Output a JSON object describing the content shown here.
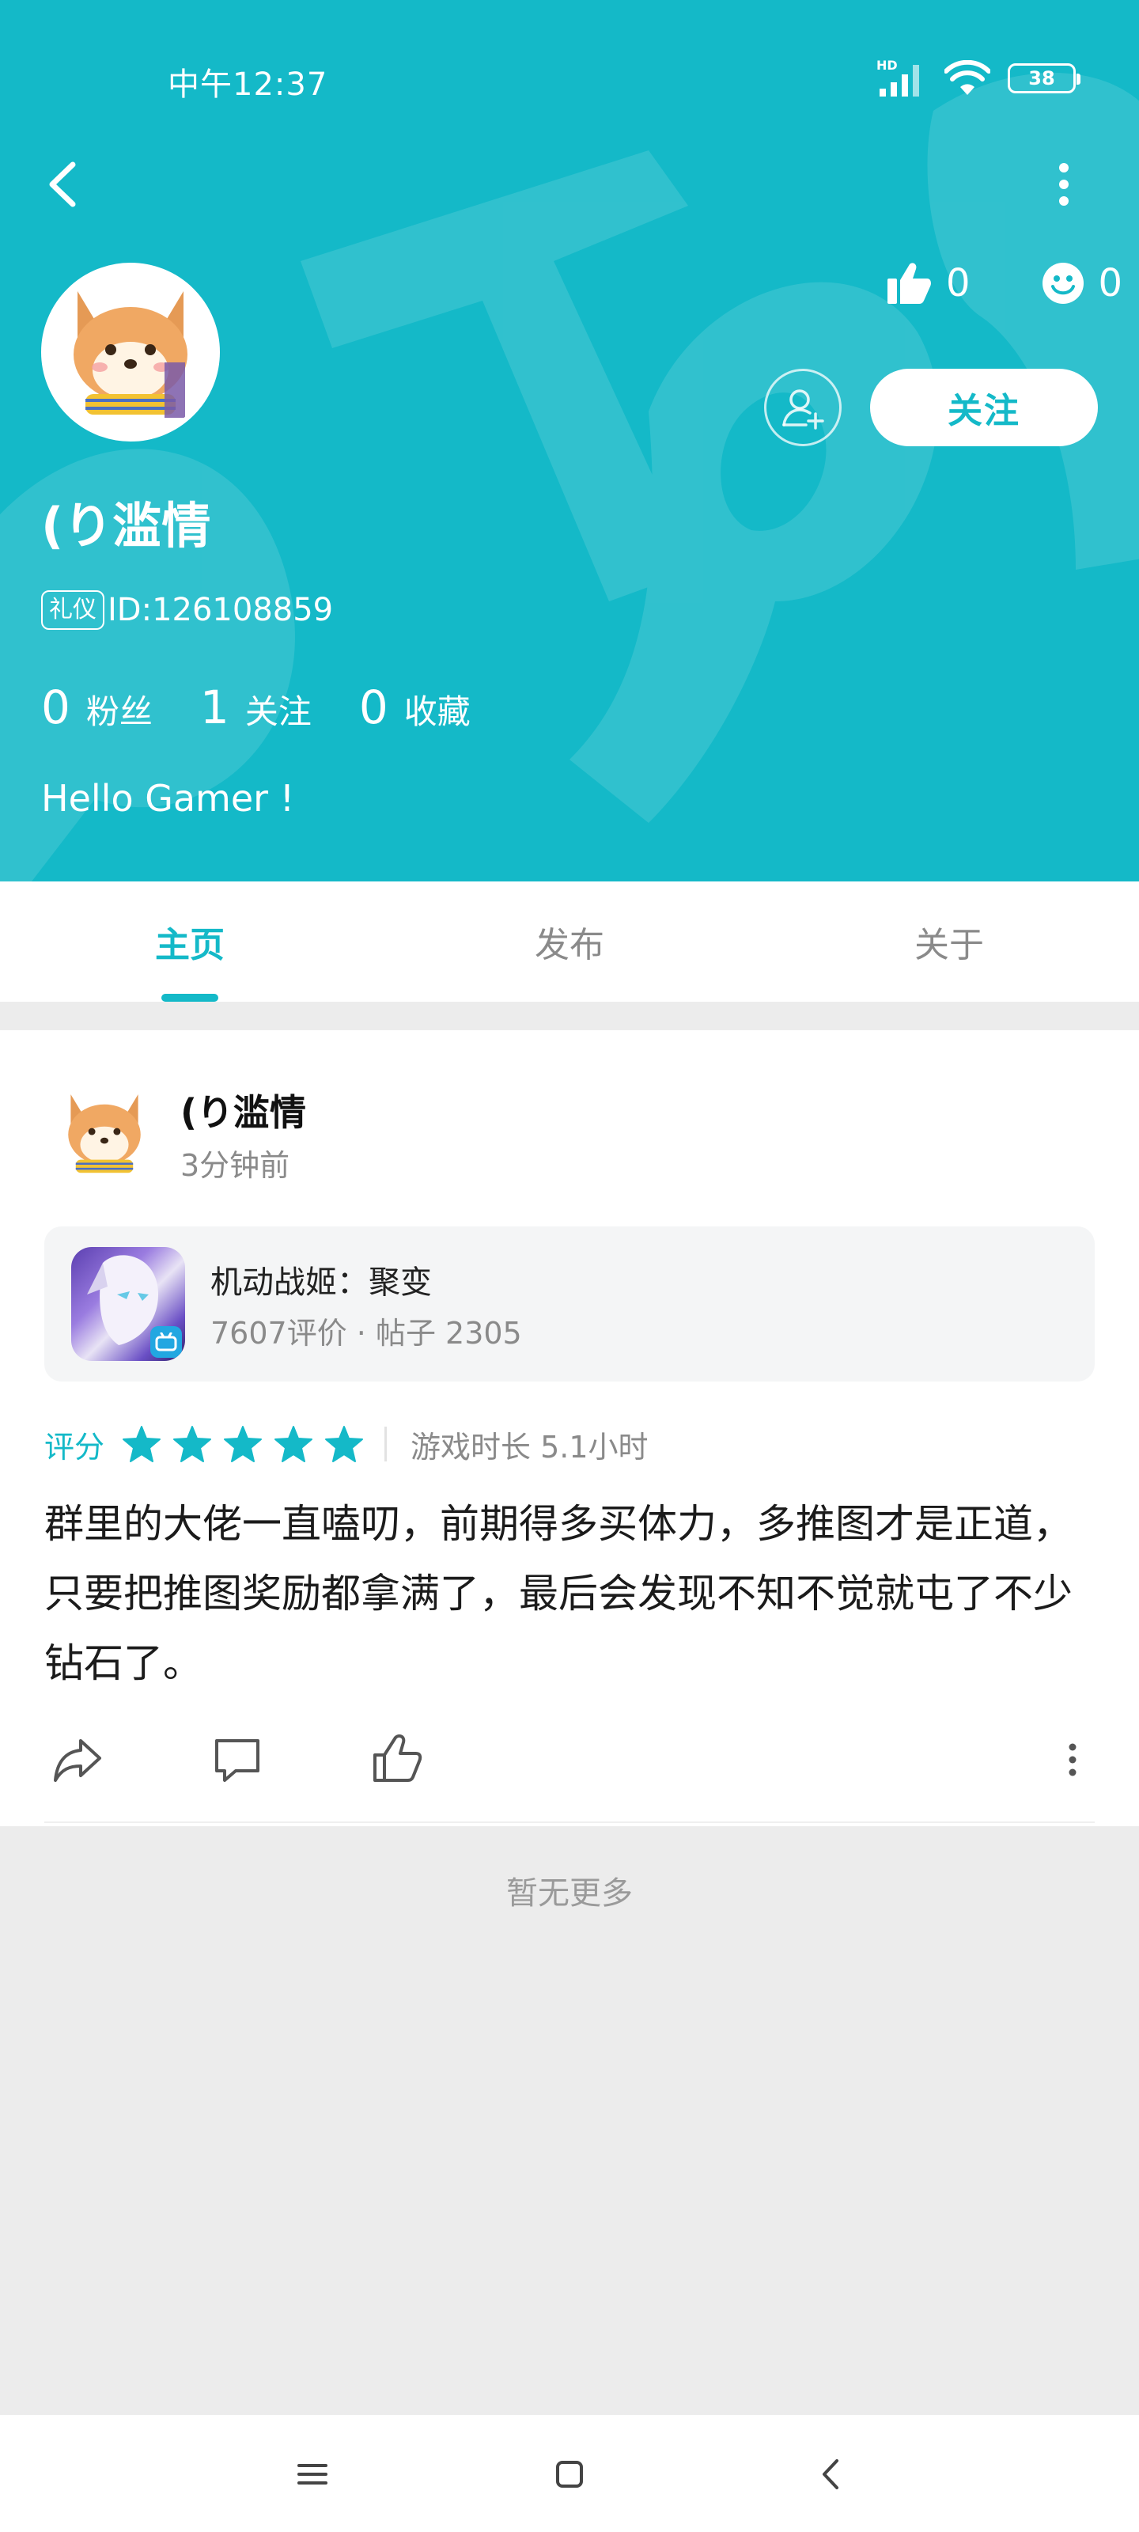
{
  "status_bar": {
    "time": "中午12:37",
    "network": "HD",
    "battery": "38"
  },
  "profile": {
    "username": "(り滥情",
    "badge": "礼仪",
    "id_label": "ID:126108859",
    "likes": "0",
    "smiles": "0",
    "follow_button": "关注",
    "counts": [
      {
        "value": "0",
        "label": "粉丝"
      },
      {
        "value": "1",
        "label": "关注"
      },
      {
        "value": "0",
        "label": "收藏"
      }
    ],
    "bio": "Hello Gamer !"
  },
  "tabs": [
    {
      "label": "主页",
      "active": true
    },
    {
      "label": "发布",
      "active": false
    },
    {
      "label": "关于",
      "active": false
    }
  ],
  "post": {
    "author": "(り滥情",
    "time": "3分钟前",
    "game": {
      "name": "机动战姬：聚变",
      "meta": "7607评价  ·  帖子 2305"
    },
    "rating_label": "评分",
    "stars": 5,
    "playtime": "游戏时长 5.1小时",
    "text": "群里的大佬一直嗑叨，前期得多买体力，多推图才是正道，只要把推图奖励都拿满了，最后会发现不知不觉就屯了不少钻石了。"
  },
  "footer_text": "暂无更多",
  "colors": {
    "accent": "#14b9c8",
    "star": "#14b9c8"
  }
}
